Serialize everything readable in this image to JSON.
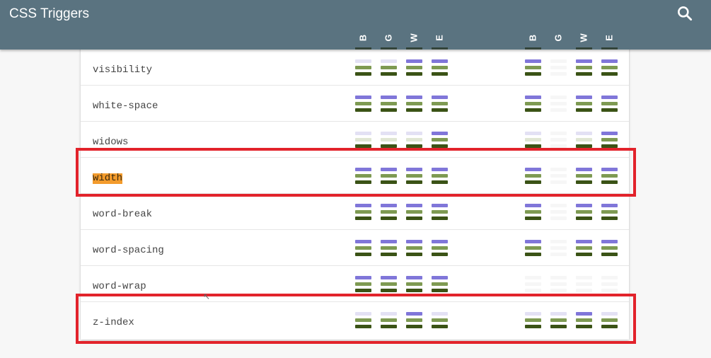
{
  "app": {
    "title": "CSS Triggers",
    "search_icon": "search-icon"
  },
  "columns": {
    "group1": [
      "B",
      "G",
      "W",
      "E"
    ],
    "group2": [
      "B",
      "G",
      "W",
      "E"
    ]
  },
  "colors": {
    "header": "#5a7380",
    "layout": "#8076d9",
    "paint": "#7e9a52",
    "composite": "#3b5316",
    "layout_faint": "#e3e1f4",
    "paint_faint": "#e0e6d4",
    "composite_faint": "#d9dfcf",
    "highlight_box": "#e2232b",
    "highlight_text": "#f39b2c"
  },
  "rows": [
    {
      "name": "visibility",
      "group1": [
        [
          0,
          1,
          1
        ],
        [
          0,
          1,
          1
        ],
        [
          1,
          1,
          1
        ],
        [
          1,
          1,
          1
        ]
      ],
      "group2": [
        [
          1,
          1,
          1
        ],
        [
          0,
          0,
          0
        ],
        [
          1,
          1,
          1
        ],
        [
          1,
          1,
          1
        ]
      ]
    },
    {
      "name": "white-space",
      "group1": [
        [
          1,
          1,
          1
        ],
        [
          1,
          1,
          1
        ],
        [
          1,
          1,
          1
        ],
        [
          1,
          1,
          1
        ]
      ],
      "group2": [
        [
          1,
          1,
          1
        ],
        [
          0,
          0,
          0
        ],
        [
          1,
          1,
          1
        ],
        [
          1,
          1,
          1
        ]
      ]
    },
    {
      "name": "widows",
      "group1": [
        [
          0,
          0,
          1
        ],
        [
          0,
          0,
          1
        ],
        [
          0,
          0,
          1
        ],
        [
          1,
          1,
          1
        ]
      ],
      "group2": [
        [
          0,
          0,
          1
        ],
        [
          0,
          0,
          0
        ],
        [
          0,
          0,
          1
        ],
        [
          1,
          1,
          1
        ]
      ]
    },
    {
      "name": "width",
      "group1": [
        [
          1,
          1,
          1
        ],
        [
          1,
          1,
          1
        ],
        [
          1,
          1,
          1
        ],
        [
          1,
          1,
          1
        ]
      ],
      "group2": [
        [
          1,
          1,
          1
        ],
        [
          0,
          0,
          0
        ],
        [
          1,
          1,
          1
        ],
        [
          1,
          1,
          1
        ]
      ]
    },
    {
      "name": "word-break",
      "group1": [
        [
          1,
          1,
          1
        ],
        [
          1,
          1,
          1
        ],
        [
          1,
          1,
          1
        ],
        [
          1,
          1,
          1
        ]
      ],
      "group2": [
        [
          1,
          1,
          1
        ],
        [
          0,
          0,
          0
        ],
        [
          1,
          1,
          1
        ],
        [
          1,
          1,
          1
        ]
      ]
    },
    {
      "name": "word-spacing",
      "group1": [
        [
          1,
          1,
          1
        ],
        [
          1,
          1,
          1
        ],
        [
          1,
          1,
          1
        ],
        [
          1,
          1,
          1
        ]
      ],
      "group2": [
        [
          1,
          1,
          1
        ],
        [
          0,
          0,
          0
        ],
        [
          1,
          1,
          1
        ],
        [
          1,
          1,
          1
        ]
      ]
    },
    {
      "name": "word-wrap",
      "group1": [
        [
          1,
          1,
          1
        ],
        [
          1,
          1,
          1
        ],
        [
          1,
          1,
          1
        ],
        [
          1,
          1,
          1
        ]
      ],
      "group2": [
        [
          0,
          0,
          0
        ],
        [
          0,
          0,
          0
        ],
        [
          0,
          0,
          0
        ],
        [
          0,
          0,
          0
        ]
      ]
    },
    {
      "name": "z-index",
      "group1": [
        [
          0,
          1,
          1
        ],
        [
          0,
          1,
          1
        ],
        [
          1,
          1,
          1
        ],
        [
          0,
          1,
          1
        ]
      ],
      "group2": [
        [
          0,
          1,
          1
        ],
        [
          0,
          1,
          1
        ],
        [
          1,
          1,
          1
        ],
        [
          0,
          1,
          1
        ]
      ]
    }
  ],
  "highlighted_rows": [
    "width",
    "z-index"
  ]
}
